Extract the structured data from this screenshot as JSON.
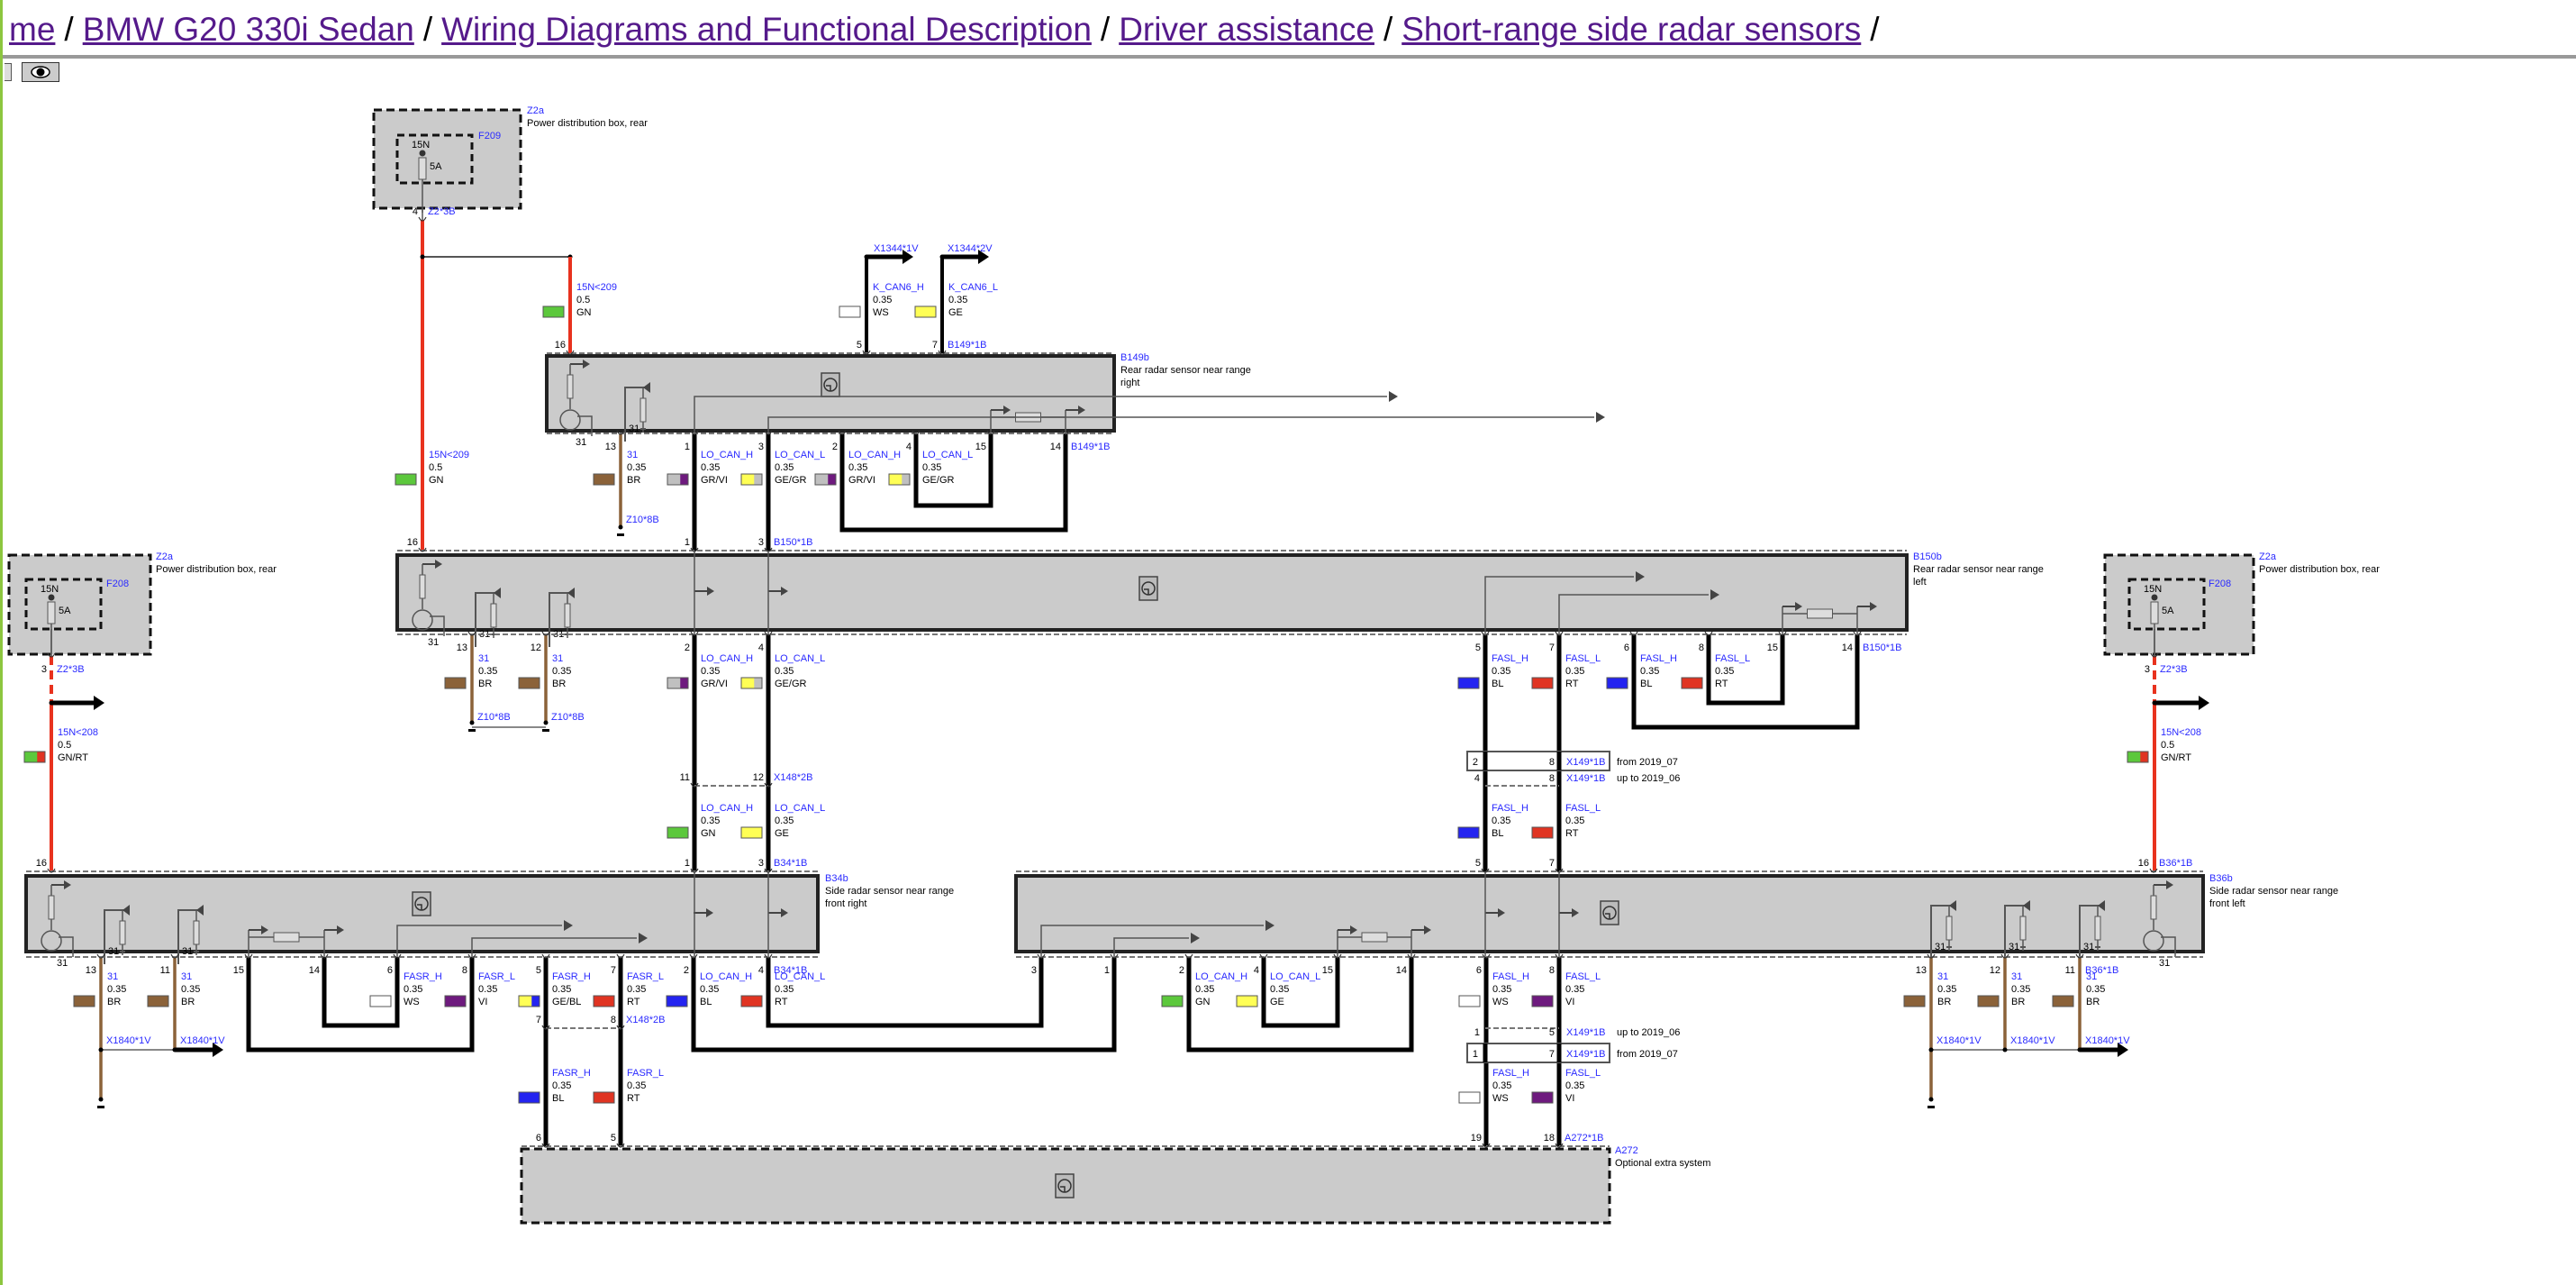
{
  "breadcrumb": {
    "items": [
      "me",
      "BMW G20 330i Sedan",
      "Wiring Diagrams and Functional Description",
      "Driver assistance",
      "Short-range side radar sensors"
    ],
    "separator": "/"
  },
  "toolbar": {
    "view_button_icon": "eye-icon"
  },
  "wire_colors": {
    "GN": "#5cc83c",
    "GE": "#ffff55",
    "WS": "#ffffff",
    "BR": "#8b6239",
    "GR": "#c0c0c0",
    "VI": "#6e1a7e",
    "BL": "#2424f0",
    "RT": "#e03422"
  },
  "supply_wire_color": "#e8321e",
  "components": [
    {
      "id": "Z2a",
      "desc": [
        "Power distribution box, rear"
      ],
      "fuse": "F209",
      "terminal": "15N",
      "rating": "5A"
    },
    {
      "id": "B149b",
      "desc": [
        "Rear radar sensor near range",
        "right"
      ]
    },
    {
      "id": "B150b",
      "desc": [
        "Rear radar sensor near range",
        "left"
      ]
    },
    {
      "id": "Z2a",
      "desc": [
        "Power distribution box, rear"
      ],
      "fuse": "F208",
      "terminal": "15N",
      "rating": "5A"
    },
    {
      "id": "Z2a",
      "desc": [
        "Power distribution box, rear"
      ],
      "fuse": "F208",
      "terminal": "15N",
      "rating": "5A"
    },
    {
      "id": "B34b",
      "desc": [
        "Side radar sensor near range",
        "front right"
      ]
    },
    {
      "id": "B36b",
      "desc": [
        "Side radar sensor near range",
        "front left"
      ]
    },
    {
      "id": "A272",
      "desc": [
        "Optional extra system"
      ]
    }
  ],
  "connectors": [
    {
      "label": "Z2*3B",
      "pins": [
        "4"
      ]
    },
    {
      "label": "B149*1B",
      "pins": [
        "16",
        "5",
        "7"
      ]
    },
    {
      "label": "B149*1B",
      "pins": [
        "13",
        "1",
        "3",
        "2",
        "4",
        "15",
        "14"
      ]
    },
    {
      "label": "B150*1B",
      "pins": [
        "16",
        "1",
        "3"
      ]
    },
    {
      "label": "B150*1B",
      "pins": [
        "13",
        "12",
        "2",
        "4",
        "5",
        "7",
        "6",
        "8",
        "15",
        "14"
      ]
    },
    {
      "label": "Z2*3B",
      "pins": [
        "3"
      ]
    },
    {
      "label": "Z2*3B",
      "pins": [
        "3"
      ]
    },
    {
      "label": "X148*2B",
      "pins": [
        "11",
        "12"
      ]
    },
    {
      "label": "B34*1B",
      "pins": [
        "16",
        "1",
        "3"
      ]
    },
    {
      "label": "B36*1B",
      "pins": [
        "5",
        "7",
        "16"
      ]
    },
    {
      "label": "B34*1B",
      "pins": [
        "13",
        "11",
        "15",
        "14",
        "6",
        "8",
        "5",
        "7",
        "2",
        "4"
      ]
    },
    {
      "label": "B36*1B",
      "pins": [
        "3",
        "1",
        "2",
        "4",
        "15",
        "14",
        "6",
        "8",
        "13",
        "12",
        "11"
      ]
    },
    {
      "label": "X148*2B",
      "pins": [
        "7",
        "8"
      ]
    },
    {
      "label": "A272*1B",
      "pins": [
        "6",
        "5",
        "19",
        "18"
      ]
    }
  ],
  "variant_connectors": [
    {
      "pins": [
        "2",
        "8"
      ],
      "label": "X149*1B",
      "note": "from 2019_07"
    },
    {
      "pins": [
        "4",
        "8"
      ],
      "label": "X149*1B",
      "note": "up to 2019_06"
    },
    {
      "pins": [
        "1",
        "5"
      ],
      "label": "X149*1B",
      "note": "up to 2019_06"
    },
    {
      "pins": [
        "1",
        "7"
      ],
      "label": "X149*1B",
      "note": "from 2019_07"
    }
  ],
  "signals": [
    {
      "label": "X1344*1V"
    },
    {
      "label": "X1344*2V"
    },
    {
      "label": "Z10*8B"
    },
    {
      "label": "Z10*8B"
    },
    {
      "label": "Z10*8B"
    },
    {
      "label": "X1840*1V"
    },
    {
      "label": "X1840*1V"
    },
    {
      "label": "X1840*1V"
    },
    {
      "label": "X1840*1V"
    },
    {
      "label": "X1840*1V"
    }
  ],
  "ground_label": "31",
  "wires": [
    {
      "name": "15N<209",
      "gauge": "0.5",
      "color": "GN"
    },
    {
      "name": "K_CAN6_H",
      "gauge": "0.35",
      "color": "WS"
    },
    {
      "name": "K_CAN6_L",
      "gauge": "0.35",
      "color": "GE"
    },
    {
      "name": "15N<209",
      "gauge": "0.5",
      "color": "GN"
    },
    {
      "name": "31",
      "gauge": "0.35",
      "color": "BR"
    },
    {
      "name": "LO_CAN_H",
      "gauge": "0.35",
      "color": "GR/VI"
    },
    {
      "name": "LO_CAN_L",
      "gauge": "0.35",
      "color": "GE/GR"
    },
    {
      "name": "LO_CAN_H",
      "gauge": "0.35",
      "color": "GR/VI"
    },
    {
      "name": "LO_CAN_L",
      "gauge": "0.35",
      "color": "GE/GR"
    },
    {
      "name": "15N<208",
      "gauge": "0.5",
      "color": "GN/RT"
    },
    {
      "name": "31",
      "gauge": "0.35",
      "color": "BR"
    },
    {
      "name": "31",
      "gauge": "0.35",
      "color": "BR"
    },
    {
      "name": "LO_CAN_H",
      "gauge": "0.35",
      "color": "GR/VI"
    },
    {
      "name": "LO_CAN_L",
      "gauge": "0.35",
      "color": "GE/GR"
    },
    {
      "name": "FASL_H",
      "gauge": "0.35",
      "color": "BL"
    },
    {
      "name": "FASL_L",
      "gauge": "0.35",
      "color": "RT"
    },
    {
      "name": "FASL_H",
      "gauge": "0.35",
      "color": "BL"
    },
    {
      "name": "FASL_L",
      "gauge": "0.35",
      "color": "RT"
    },
    {
      "name": "15N<208",
      "gauge": "0.5",
      "color": "GN/RT"
    },
    {
      "name": "LO_CAN_H",
      "gauge": "0.35",
      "color": "GN"
    },
    {
      "name": "LO_CAN_L",
      "gauge": "0.35",
      "color": "GE"
    },
    {
      "name": "FASL_H",
      "gauge": "0.35",
      "color": "BL"
    },
    {
      "name": "FASL_L",
      "gauge": "0.35",
      "color": "RT"
    },
    {
      "name": "31",
      "gauge": "0.35",
      "color": "BR"
    },
    {
      "name": "31",
      "gauge": "0.35",
      "color": "BR"
    },
    {
      "name": "FASR_H",
      "gauge": "0.35",
      "color": "WS"
    },
    {
      "name": "FASR_L",
      "gauge": "0.35",
      "color": "VI"
    },
    {
      "name": "FASR_H",
      "gauge": "0.35",
      "color": "GE/BL"
    },
    {
      "name": "FASR_L",
      "gauge": "0.35",
      "color": "RT"
    },
    {
      "name": "LO_CAN_H",
      "gauge": "0.35",
      "color": "BL"
    },
    {
      "name": "LO_CAN_L",
      "gauge": "0.35",
      "color": "RT"
    },
    {
      "name": "LO_CAN_H",
      "gauge": "0.35",
      "color": "GN"
    },
    {
      "name": "LO_CAN_L",
      "gauge": "0.35",
      "color": "GE"
    },
    {
      "name": "FASL_H",
      "gauge": "0.35",
      "color": "WS"
    },
    {
      "name": "FASL_L",
      "gauge": "0.35",
      "color": "VI"
    },
    {
      "name": "31",
      "gauge": "0.35",
      "color": "BR"
    },
    {
      "name": "31",
      "gauge": "0.35",
      "color": "BR"
    },
    {
      "name": "31",
      "gauge": "0.35",
      "color": "BR"
    },
    {
      "name": "FASR_H",
      "gauge": "0.35",
      "color": "BL"
    },
    {
      "name": "FASR_L",
      "gauge": "0.35",
      "color": "RT"
    },
    {
      "name": "FASL_H",
      "gauge": "0.35",
      "color": "WS"
    },
    {
      "name": "FASL_L",
      "gauge": "0.35",
      "color": "VI"
    }
  ]
}
